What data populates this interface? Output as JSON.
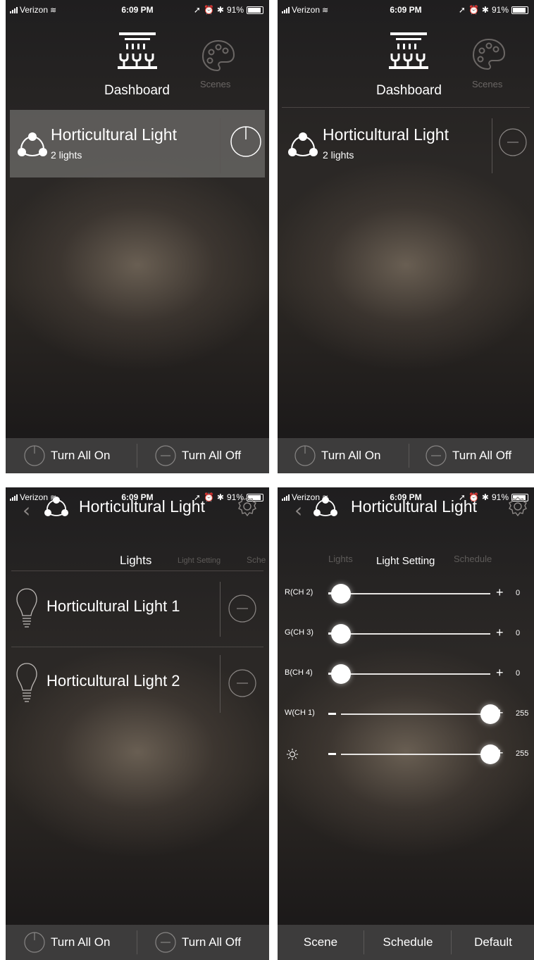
{
  "status_bar": {
    "carrier": "Verizon",
    "time": "6:09 PM",
    "battery": "91%"
  },
  "nav": {
    "dashboard": "Dashboard",
    "scenes": "Scenes"
  },
  "group": {
    "name": "Horticultural Light",
    "sub": "2 lights"
  },
  "bottom": {
    "on": "Turn All On",
    "off": "Turn All Off"
  },
  "detail": {
    "title": "Horticultural Light",
    "tabs": {
      "lights": "Lights",
      "setting": "Light Setting",
      "schedule": "Schedule",
      "schedule_partial": "Sche"
    }
  },
  "lights": [
    {
      "name": "Horticultural Light 1"
    },
    {
      "name": "Horticultural Light 2"
    }
  ],
  "sliders": [
    {
      "label": "R(CH 2)",
      "value": "0",
      "fraction": 0.0
    },
    {
      "label": "G(CH 3)",
      "value": "0",
      "fraction": 0.0
    },
    {
      "label": "B(CH 4)",
      "value": "0",
      "fraction": 0.0
    },
    {
      "label": "W(CH 1)",
      "value": "255",
      "fraction": 1.0
    },
    {
      "label": "",
      "icon": "brightness-icon",
      "value": "255",
      "fraction": 1.0
    }
  ],
  "setting_bottom": {
    "scene": "Scene",
    "schedule": "Schedule",
    "default": "Default"
  },
  "colors": {
    "selected_row": "#6e6c6a",
    "bottom_bar": "#3d3c3c",
    "inactive_text": "#6b6765"
  }
}
